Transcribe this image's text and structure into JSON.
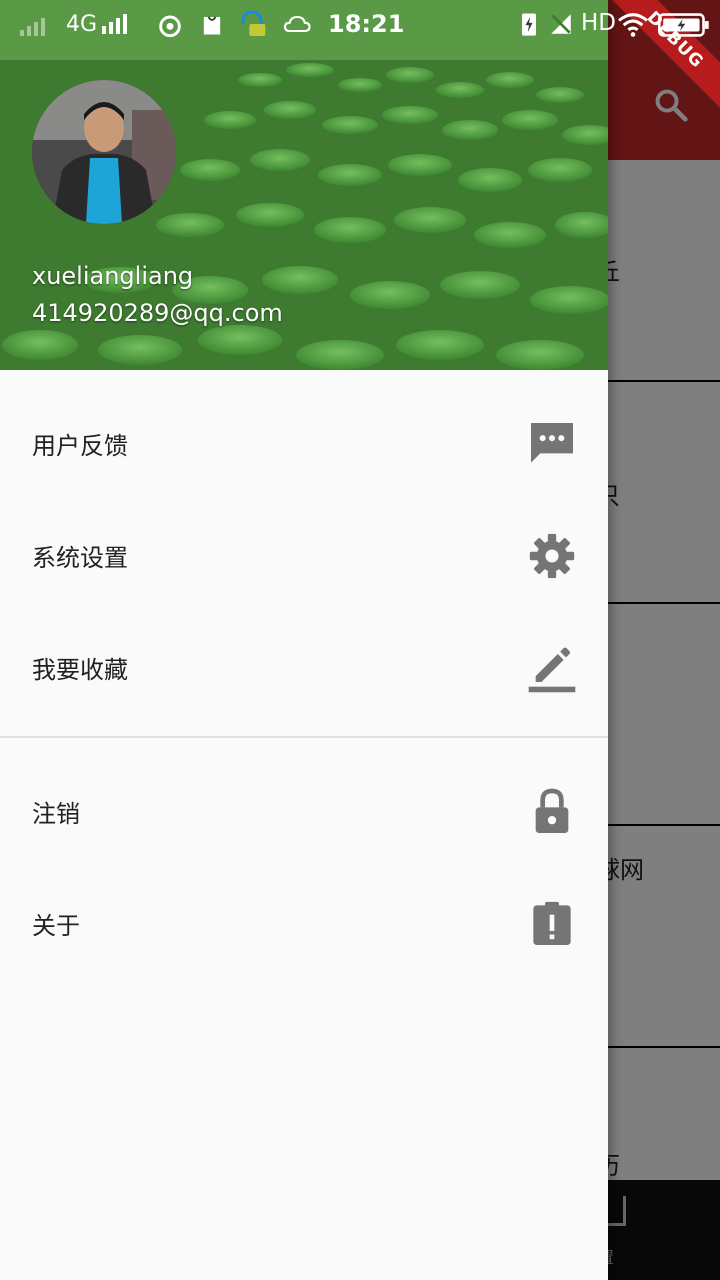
{
  "status_bar": {
    "network": "4G",
    "time": "18:21",
    "hd": "HD"
  },
  "debug_banner": "DEBUG",
  "background": {
    "rows": [
      "丘",
      "只",
      "球网",
      "历"
    ],
    "bottom_label": "置"
  },
  "drawer": {
    "username": "xueliangliang",
    "email": "414920289@qq.com",
    "menu": [
      {
        "label": "用户反馈",
        "icon": "feedback-icon"
      },
      {
        "label": "系统设置",
        "icon": "settings-icon"
      },
      {
        "label": "我要收藏",
        "icon": "edit-icon"
      },
      {
        "label": "注销",
        "icon": "lock-icon"
      },
      {
        "label": "关于",
        "icon": "about-icon"
      }
    ]
  },
  "colors": {
    "appbar": "#c62828",
    "drawer_bg": "#fafafa",
    "icon": "#757575"
  }
}
